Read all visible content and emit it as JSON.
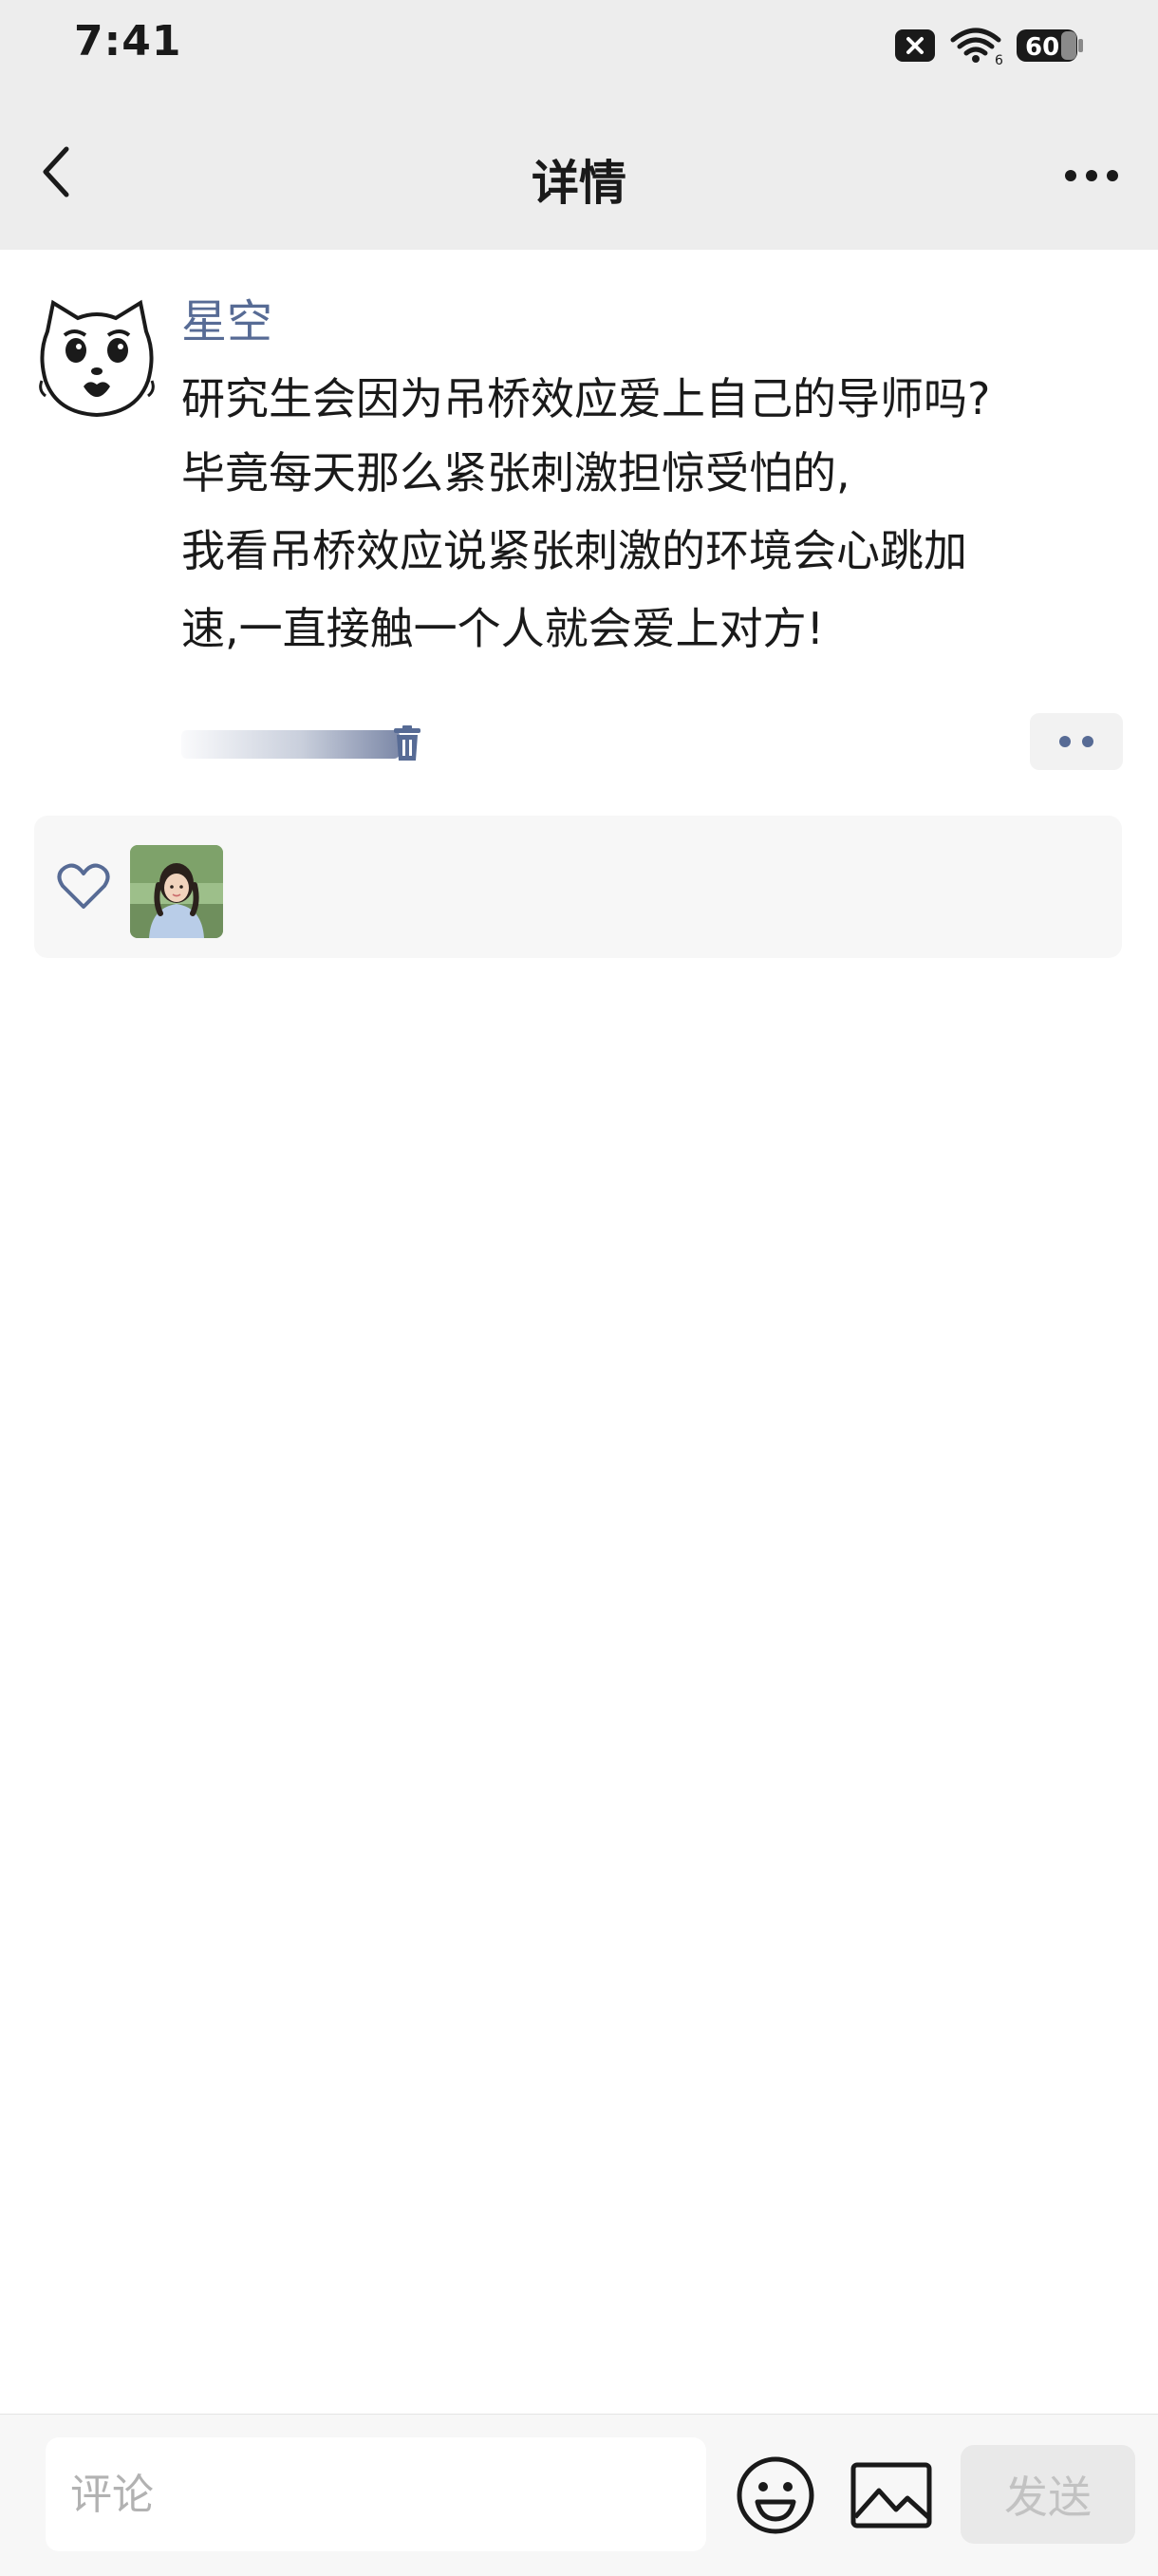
{
  "status_bar": {
    "time": "7:41",
    "battery": "60",
    "network_label": "6",
    "icons": [
      "notification-blocked-icon",
      "wifi-icon",
      "battery-icon"
    ]
  },
  "nav": {
    "title": "详情",
    "back_icon": "chevron-left-icon",
    "more_icon": "more-dots-icon"
  },
  "post": {
    "author": "星空",
    "avatar_icon": "cartoon-cat-avatar",
    "lines": [
      "研究生会因为吊桥效应爱上自己的导师吗?",
      "毕竟每天那么紧张刺激担惊受怕的,",
      "我看吊桥效应说紧张刺激的环境会心跳加",
      "速,一直接触一个人就会爱上对方!"
    ],
    "delete_icon": "trash-icon",
    "action_icon": "two-dots-icon"
  },
  "likes": {
    "icon": "heart-icon",
    "avatars": [
      "user-photo-avatar"
    ]
  },
  "comment_bar": {
    "placeholder": "评论",
    "emoji_icon": "smiley-icon",
    "image_icon": "image-icon",
    "send_label": "发送"
  },
  "colors": {
    "header_bg": "#ededed",
    "author_link": "#576b95",
    "likes_bg": "#f7f7f7",
    "send_disabled_bg": "#e9e9e9",
    "send_disabled_text": "#c2c2c2"
  }
}
